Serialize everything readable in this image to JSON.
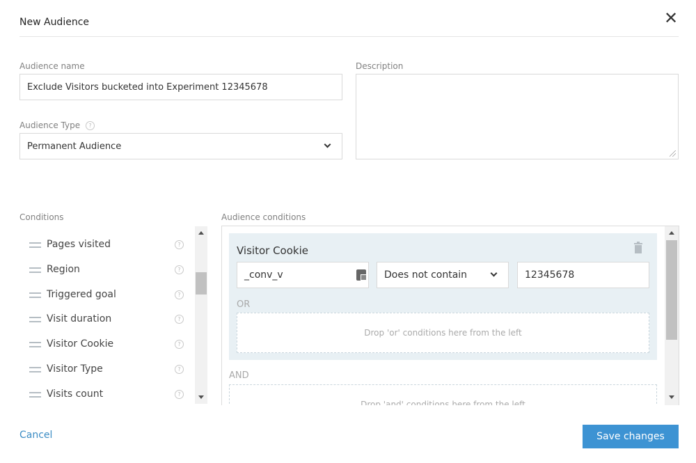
{
  "dialog": {
    "title": "New Audience",
    "close_symbol": "✕"
  },
  "form": {
    "audience_name_label": "Audience name",
    "audience_name_value": "Exclude Visitors bucketed into Experiment 12345678",
    "description_label": "Description",
    "description_value": "",
    "audience_type_label": "Audience Type",
    "audience_type_value": "Permanent Audience"
  },
  "conditions": {
    "label": "Conditions",
    "items": [
      {
        "label": "Pages visited"
      },
      {
        "label": "Region"
      },
      {
        "label": "Triggered goal"
      },
      {
        "label": "Visit duration"
      },
      {
        "label": "Visitor Cookie"
      },
      {
        "label": "Visitor Type"
      },
      {
        "label": "Visits count"
      }
    ]
  },
  "audience_conditions": {
    "label": "Audience conditions",
    "card": {
      "title": "Visitor Cookie",
      "cookie_name": "_conv_v",
      "operator": "Does not contain",
      "value": "12345678",
      "or_label": "OR",
      "or_drop_text": "Drop 'or' conditions here from the left"
    },
    "and_label": "AND",
    "and_drop_text": "Drop 'and' conditions here from the left"
  },
  "footer": {
    "cancel_label": "Cancel",
    "save_label": "Save changes"
  },
  "colors": {
    "accent": "#3d93d3",
    "link": "#3b8cc4",
    "card_background": "#e8f0f4"
  },
  "icons": {
    "help": "question-circle-icon",
    "drag": "drag-handle-icon",
    "delete": "trash-icon",
    "cookie": "cookie-picker-icon",
    "close": "close-icon"
  }
}
